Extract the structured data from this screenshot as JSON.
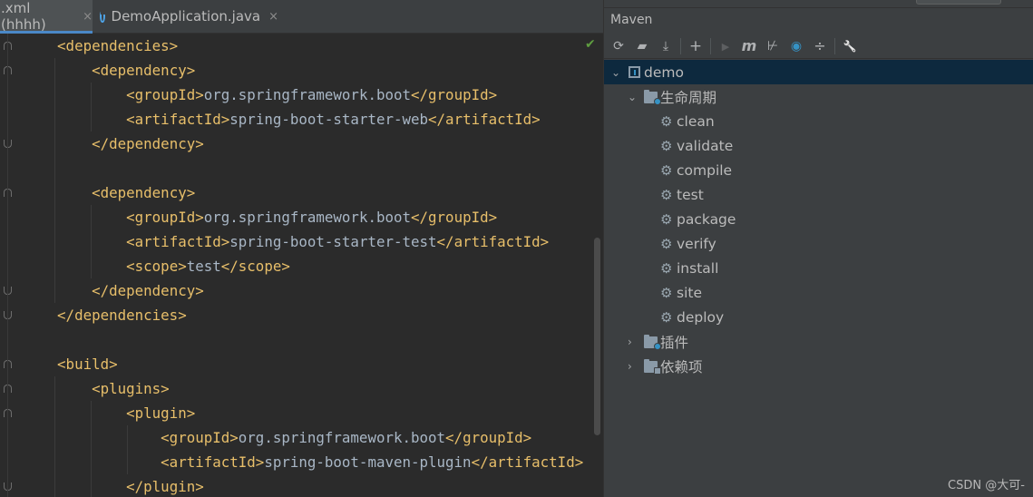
{
  "editor": {
    "tabs": [
      {
        "label": ".xml (hhhh)",
        "close": "×",
        "active": true
      },
      {
        "label": "DemoApplication.java",
        "close": "×",
        "active": false
      }
    ],
    "lines": [
      {
        "indent": "    ",
        "segments": [
          {
            "t": "<dependencies>",
            "c": "tag"
          }
        ]
      },
      {
        "indent": "        ",
        "segments": [
          {
            "t": "<dependency>",
            "c": "tag"
          }
        ]
      },
      {
        "indent": "            ",
        "segments": [
          {
            "t": "<groupId>",
            "c": "tag"
          },
          {
            "t": "org.springframework.boot",
            "c": "text"
          },
          {
            "t": "</groupId>",
            "c": "tag"
          }
        ]
      },
      {
        "indent": "            ",
        "segments": [
          {
            "t": "<artifactId>",
            "c": "tag"
          },
          {
            "t": "spring-boot-starter-web",
            "c": "text"
          },
          {
            "t": "</artifactId>",
            "c": "tag"
          }
        ]
      },
      {
        "indent": "        ",
        "segments": [
          {
            "t": "</dependency>",
            "c": "tag"
          }
        ]
      },
      {
        "indent": "",
        "segments": []
      },
      {
        "indent": "        ",
        "segments": [
          {
            "t": "<dependency>",
            "c": "tag"
          }
        ]
      },
      {
        "indent": "            ",
        "segments": [
          {
            "t": "<groupId>",
            "c": "tag"
          },
          {
            "t": "org.springframework.boot",
            "c": "text"
          },
          {
            "t": "</groupId>",
            "c": "tag"
          }
        ]
      },
      {
        "indent": "            ",
        "segments": [
          {
            "t": "<artifactId>",
            "c": "tag"
          },
          {
            "t": "spring-boot-starter-test",
            "c": "text"
          },
          {
            "t": "</artifactId>",
            "c": "tag"
          }
        ]
      },
      {
        "indent": "            ",
        "segments": [
          {
            "t": "<scope>",
            "c": "tag"
          },
          {
            "t": "test",
            "c": "text"
          },
          {
            "t": "</scope>",
            "c": "tag"
          }
        ]
      },
      {
        "indent": "        ",
        "segments": [
          {
            "t": "</dependency>",
            "c": "tag"
          }
        ]
      },
      {
        "indent": "    ",
        "segments": [
          {
            "t": "</dependencies>",
            "c": "tag"
          }
        ]
      },
      {
        "indent": "",
        "segments": []
      },
      {
        "indent": "    ",
        "segments": [
          {
            "t": "<build>",
            "c": "tag"
          }
        ]
      },
      {
        "indent": "        ",
        "segments": [
          {
            "t": "<plugins>",
            "c": "tag"
          }
        ]
      },
      {
        "indent": "            ",
        "segments": [
          {
            "t": "<plugin>",
            "c": "tag"
          }
        ]
      },
      {
        "indent": "                ",
        "segments": [
          {
            "t": "<groupId>",
            "c": "tag"
          },
          {
            "t": "org.springframework.boot",
            "c": "text"
          },
          {
            "t": "</groupId>",
            "c": "tag"
          }
        ]
      },
      {
        "indent": "                ",
        "segments": [
          {
            "t": "<artifactId>",
            "c": "tag"
          },
          {
            "t": "spring-boot-maven-plugin",
            "c": "text"
          },
          {
            "t": "</artifactId>",
            "c": "tag"
          }
        ]
      },
      {
        "indent": "            ",
        "segments": [
          {
            "t": "</plugin>",
            "c": "tag"
          }
        ]
      }
    ]
  },
  "maven": {
    "title": "Maven",
    "toolbar": [
      {
        "name": "reload-icon",
        "glyph": "⟳",
        "enabled": true
      },
      {
        "name": "generate-sources-icon",
        "glyph": "▰",
        "enabled": true
      },
      {
        "name": "download-icon",
        "glyph": "⤓",
        "enabled": true
      },
      {
        "name": "add-project-icon",
        "glyph": "+",
        "enabled": true
      },
      {
        "name": "run-icon",
        "glyph": "▶",
        "enabled": false
      },
      {
        "name": "execute-goal-icon",
        "glyph": "m",
        "enabled": true
      },
      {
        "name": "skip-tests-icon",
        "glyph": "⊬",
        "enabled": true
      },
      {
        "name": "offline-icon",
        "glyph": "◉",
        "enabled": true
      },
      {
        "name": "collapse-all-icon",
        "glyph": "÷",
        "enabled": true
      },
      {
        "name": "settings-wrench-icon",
        "glyph": "🔧",
        "enabled": true
      }
    ],
    "tree": {
      "project": "demo",
      "lifecycle": "生命周期",
      "goals": [
        "clean",
        "validate",
        "compile",
        "test",
        "package",
        "verify",
        "install",
        "site",
        "deploy"
      ],
      "plugins": "插件",
      "dependencies": "依赖项"
    }
  },
  "watermark": "CSDN @大可-",
  "colors": {
    "tag": "#e8bf6a",
    "text": "#a9b7c6",
    "accent": "#4a88c7",
    "selection": "#0d293e",
    "red_mark": "#ee1b1b"
  }
}
